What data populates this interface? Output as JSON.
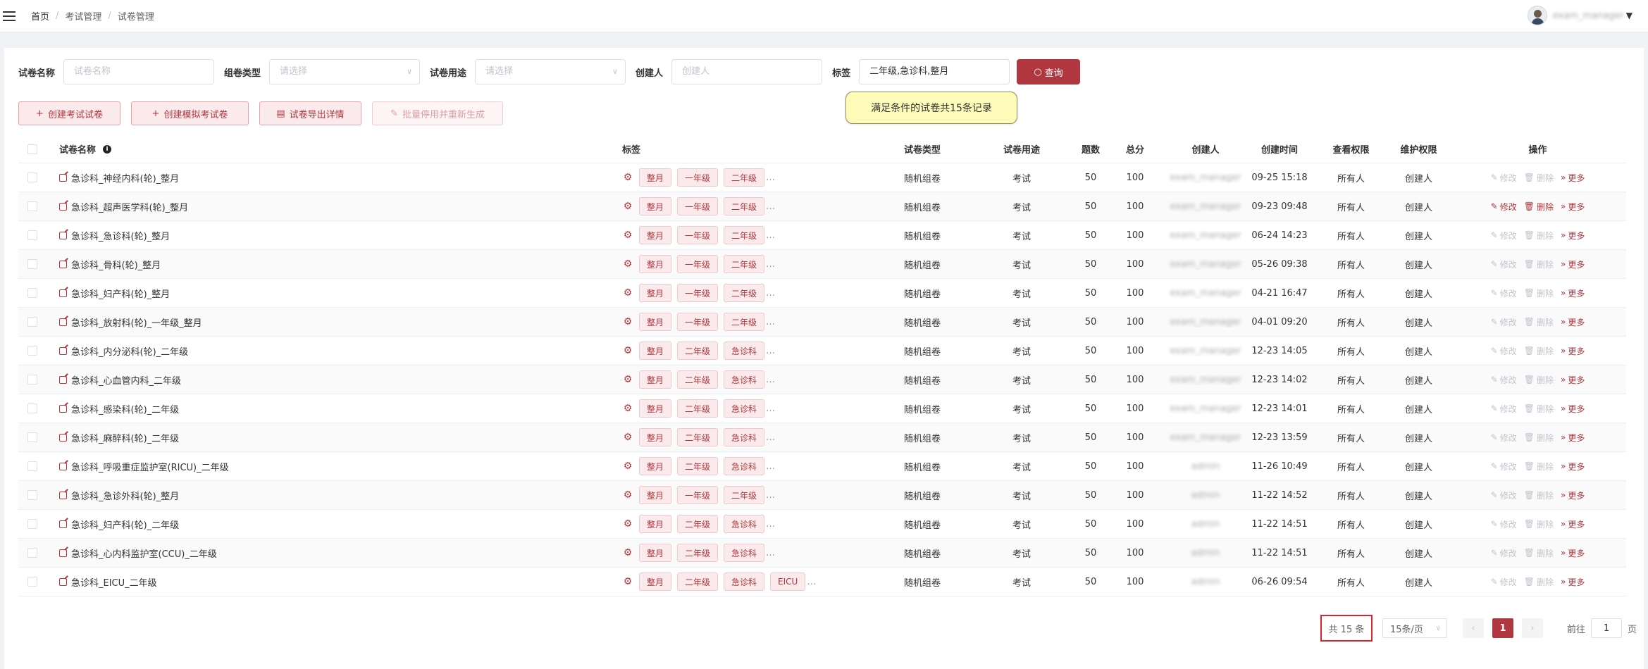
{
  "breadcrumb": [
    "首页",
    "考试管理",
    "试卷管理"
  ],
  "user": {
    "name": "exam_manager"
  },
  "filters": {
    "name_label": "试卷名称",
    "name_placeholder": "试卷名称",
    "type_label": "组卷类型",
    "type_placeholder": "请选择",
    "use_label": "试卷用途",
    "use_placeholder": "请选择",
    "creator_label": "创建人",
    "creator_placeholder": "创建人",
    "tag_label": "标签",
    "tag_value": "二年级,急诊科,整月",
    "query_label": "查询"
  },
  "actions": {
    "create_exam": "创建考试试卷",
    "create_mock": "创建模拟考试卷",
    "export": "试卷导出详情",
    "batch_disable": "批量停用并重新生成"
  },
  "tooltip": "满足条件的试卷共15条记录",
  "columns": {
    "name": "试卷名称",
    "tags": "标签",
    "type": "试卷类型",
    "use": "试卷用途",
    "count": "题数",
    "score": "总分",
    "creator": "创建人",
    "time": "创建时间",
    "view": "查看权限",
    "maint": "维护权限",
    "ops": "操作"
  },
  "ops": {
    "edit": "修改",
    "delete": "删除",
    "more": "更多"
  },
  "rows": [
    {
      "name": "急诊科_神经内科(轮)_整月",
      "tags": [
        "整月",
        "一年级",
        "二年级"
      ],
      "type": "随机组卷",
      "use": "考试",
      "count": "50",
      "score": "100",
      "creator": "exam_manager",
      "time": "09-25 15:18",
      "view": "所有人",
      "maint": "创建人"
    },
    {
      "name": "急诊科_超声医学科(轮)_整月",
      "tags": [
        "整月",
        "一年级",
        "二年级"
      ],
      "type": "随机组卷",
      "use": "考试",
      "count": "50",
      "score": "100",
      "creator": "exam_manager",
      "time": "09-23 09:48",
      "view": "所有人",
      "maint": "创建人"
    },
    {
      "name": "急诊科_急诊科(轮)_整月",
      "tags": [
        "整月",
        "一年级",
        "二年级"
      ],
      "type": "随机组卷",
      "use": "考试",
      "count": "50",
      "score": "100",
      "creator": "exam_manager",
      "time": "06-24 14:23",
      "view": "所有人",
      "maint": "创建人"
    },
    {
      "name": "急诊科_骨科(轮)_整月",
      "tags": [
        "整月",
        "一年级",
        "二年级"
      ],
      "type": "随机组卷",
      "use": "考试",
      "count": "50",
      "score": "100",
      "creator": "exam_manager",
      "time": "05-26 09:38",
      "view": "所有人",
      "maint": "创建人"
    },
    {
      "name": "急诊科_妇产科(轮)_整月",
      "tags": [
        "整月",
        "一年级",
        "二年级"
      ],
      "type": "随机组卷",
      "use": "考试",
      "count": "50",
      "score": "100",
      "creator": "exam_manager",
      "time": "04-21 16:47",
      "view": "所有人",
      "maint": "创建人"
    },
    {
      "name": "急诊科_放射科(轮)_一年级_整月",
      "tags": [
        "整月",
        "一年级",
        "二年级"
      ],
      "type": "随机组卷",
      "use": "考试",
      "count": "50",
      "score": "100",
      "creator": "exam_manager",
      "time": "04-01 09:20",
      "view": "所有人",
      "maint": "创建人"
    },
    {
      "name": "急诊科_内分泌科(轮)_二年级",
      "tags": [
        "整月",
        "二年级",
        "急诊科"
      ],
      "type": "随机组卷",
      "use": "考试",
      "count": "50",
      "score": "100",
      "creator": "exam_manager",
      "time": "12-23 14:05",
      "view": "所有人",
      "maint": "创建人"
    },
    {
      "name": "急诊科_心血管内科_二年级",
      "tags": [
        "整月",
        "二年级",
        "急诊科"
      ],
      "type": "随机组卷",
      "use": "考试",
      "count": "50",
      "score": "100",
      "creator": "exam_manager",
      "time": "12-23 14:02",
      "view": "所有人",
      "maint": "创建人"
    },
    {
      "name": "急诊科_感染科(轮)_二年级",
      "tags": [
        "整月",
        "二年级",
        "急诊科"
      ],
      "type": "随机组卷",
      "use": "考试",
      "count": "50",
      "score": "100",
      "creator": "exam_manager",
      "time": "12-23 14:01",
      "view": "所有人",
      "maint": "创建人"
    },
    {
      "name": "急诊科_麻醉科(轮)_二年级",
      "tags": [
        "整月",
        "二年级",
        "急诊科"
      ],
      "type": "随机组卷",
      "use": "考试",
      "count": "50",
      "score": "100",
      "creator": "exam_manager",
      "time": "12-23 13:59",
      "view": "所有人",
      "maint": "创建人"
    },
    {
      "name": "急诊科_呼吸重症监护室(RICU)_二年级",
      "tags": [
        "整月",
        "二年级",
        "急诊科"
      ],
      "type": "随机组卷",
      "use": "考试",
      "count": "50",
      "score": "100",
      "creator": "admin",
      "time": "11-26 10:49",
      "view": "所有人",
      "maint": "创建人"
    },
    {
      "name": "急诊科_急诊外科(轮)_整月",
      "tags": [
        "整月",
        "一年级",
        "二年级"
      ],
      "type": "随机组卷",
      "use": "考试",
      "count": "50",
      "score": "100",
      "creator": "admin",
      "time": "11-22 14:52",
      "view": "所有人",
      "maint": "创建人"
    },
    {
      "name": "急诊科_妇产科(轮)_二年级",
      "tags": [
        "整月",
        "二年级",
        "急诊科"
      ],
      "type": "随机组卷",
      "use": "考试",
      "count": "50",
      "score": "100",
      "creator": "admin",
      "time": "11-22 14:51",
      "view": "所有人",
      "maint": "创建人"
    },
    {
      "name": "急诊科_心内科监护室(CCU)_二年级",
      "tags": [
        "整月",
        "二年级",
        "急诊科"
      ],
      "type": "随机组卷",
      "use": "考试",
      "count": "50",
      "score": "100",
      "creator": "admin",
      "time": "11-22 14:51",
      "view": "所有人",
      "maint": "创建人"
    },
    {
      "name": "急诊科_EICU_二年级",
      "tags": [
        "整月",
        "二年级",
        "急诊科",
        "EICU"
      ],
      "type": "随机组卷",
      "use": "考试",
      "count": "50",
      "score": "100",
      "creator": "admin",
      "time": "06-26 09:54",
      "view": "所有人",
      "maint": "创建人"
    }
  ],
  "pagination": {
    "total": "共 15 条",
    "page_size": "15条/页",
    "current": "1",
    "goto_label": "前往",
    "goto_value": "1",
    "page_unit": "页"
  },
  "colors": {
    "primary": "#b0373f",
    "tag_bg": "#fbeaeb",
    "tooltip_bg": "#fffbb8"
  }
}
